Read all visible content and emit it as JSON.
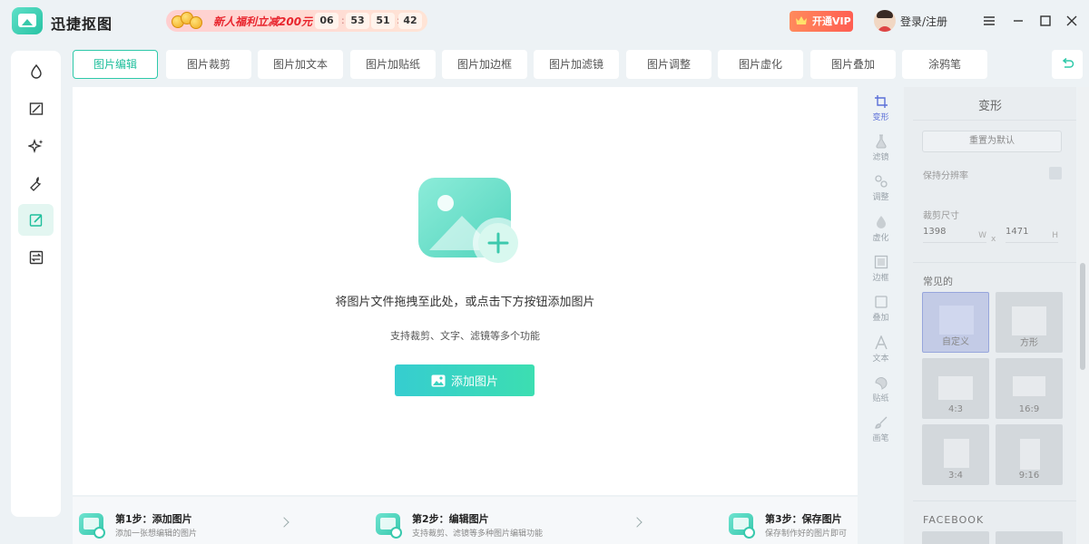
{
  "app": {
    "title": "迅捷抠图"
  },
  "promo": {
    "text": "新人福利立减200元",
    "countdown": [
      "06",
      "53",
      "51",
      "42"
    ]
  },
  "header": {
    "vip_label": "开通VIP",
    "login_label": "登录/注册"
  },
  "sidebar": {
    "items": [
      {
        "icon": "drop-icon"
      },
      {
        "icon": "image-edit-icon"
      },
      {
        "icon": "sparkle-icon"
      },
      {
        "icon": "wrench-icon"
      },
      {
        "icon": "pencil-square-icon",
        "active": true
      },
      {
        "icon": "convert-icon"
      }
    ]
  },
  "tabs": [
    {
      "label": "图片编辑",
      "active": true
    },
    {
      "label": "图片裁剪"
    },
    {
      "label": "图片加文本"
    },
    {
      "label": "图片加贴纸"
    },
    {
      "label": "图片加边框"
    },
    {
      "label": "图片加滤镜"
    },
    {
      "label": "图片调整"
    },
    {
      "label": "图片虚化"
    },
    {
      "label": "图片叠加"
    },
    {
      "label": "涂鸦笔"
    }
  ],
  "canvas": {
    "drop_title": "将图片文件拖拽至此处，或点击下方按钮添加图片",
    "drop_sub": "支持裁剪、文字、滤镜等多个功能",
    "add_button": "添加图片"
  },
  "steps": [
    {
      "title": "第1步：添加图片",
      "desc": "添加一张想编辑的图片"
    },
    {
      "title": "第2步：编辑图片",
      "desc": "支持裁剪、滤镜等多种图片编辑功能"
    },
    {
      "title": "第3步：保存图片",
      "desc": "保存制作好的图片即可"
    }
  ],
  "rail": [
    {
      "label": "变形",
      "icon": "crop-icon",
      "active": true
    },
    {
      "label": "滤镜",
      "icon": "flask-icon"
    },
    {
      "label": "调整",
      "icon": "adjust-icon"
    },
    {
      "label": "虚化",
      "icon": "blur-drop-icon"
    },
    {
      "label": "边框",
      "icon": "frame-icon"
    },
    {
      "label": "叠加",
      "icon": "overlay-icon"
    },
    {
      "label": "文本",
      "icon": "text-icon"
    },
    {
      "label": "贴纸",
      "icon": "sticker-icon"
    },
    {
      "label": "画笔",
      "icon": "brush-icon"
    }
  ],
  "panel": {
    "title": "变形",
    "reset_label": "重置为默认",
    "keep_resolution_label": "保持分辨率",
    "crop_size_label": "裁剪尺寸",
    "width": {
      "value": "1398",
      "unit": "W"
    },
    "height": {
      "value": "1471",
      "unit": "H"
    },
    "times": "x",
    "common_label": "常见的",
    "ratios": [
      {
        "label": "自定义",
        "active": true
      },
      {
        "label": "方形"
      },
      {
        "label": "4:3"
      },
      {
        "label": "16:9"
      },
      {
        "label": "3:4"
      },
      {
        "label": "9:16"
      }
    ],
    "facebook_label": "FACEBOOK"
  },
  "colors": {
    "accent": "#2ec9a9",
    "rail_active": "#5b6fd8",
    "vip": "#ff5e52",
    "promo_text": "#e8252d"
  }
}
